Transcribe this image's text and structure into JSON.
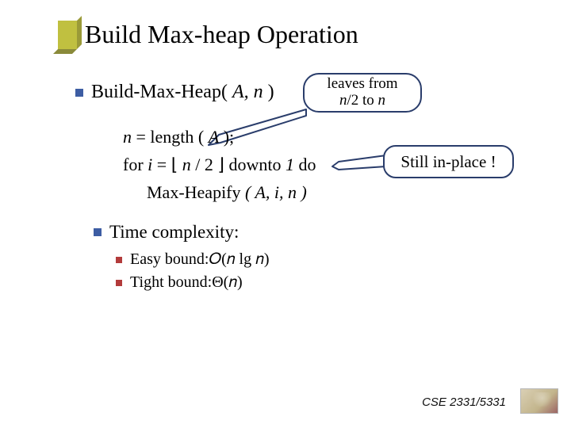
{
  "title": "Build Max-heap Operation",
  "main": {
    "build_label_pre": "Build-Max-Heap( ",
    "build_args": "A, n",
    "build_label_post": " )"
  },
  "callout_leaves": {
    "line1": "leaves from",
    "line2_pre": "",
    "line2_ital": "n",
    "line2_mid": "/2 to ",
    "line2_ital2": "n"
  },
  "algo": {
    "l1_pre": "n",
    "l1_mid": " = length ( ",
    "l1_arg": "A",
    "l1_post": " );",
    "l2_pre": "for  ",
    "l2_i": "i",
    "l2_eq": " = ",
    "l2_floor_open": "⌊",
    "l2_expr_n": " n ",
    "l2_expr_div": "/ 2 ",
    "l2_floor_close": "⌋",
    "l2_down": "   downto ",
    "l2_one": "1",
    "l2_do": "  do",
    "l3_call": "Max-Heapify",
    "l3_args_open": " ( ",
    "l3_args": "A, i, n",
    "l3_args_close": " )"
  },
  "callout_inplace": "Still in-place !",
  "complexity": {
    "heading": "Time complexity:",
    "easy_label": "Easy bound: ",
    "easy_math": "𝑂(𝑛 lg 𝑛)",
    "tight_label": "Tight bound: ",
    "tight_math": "Θ(𝑛)"
  },
  "footer": "CSE 2331/5331"
}
